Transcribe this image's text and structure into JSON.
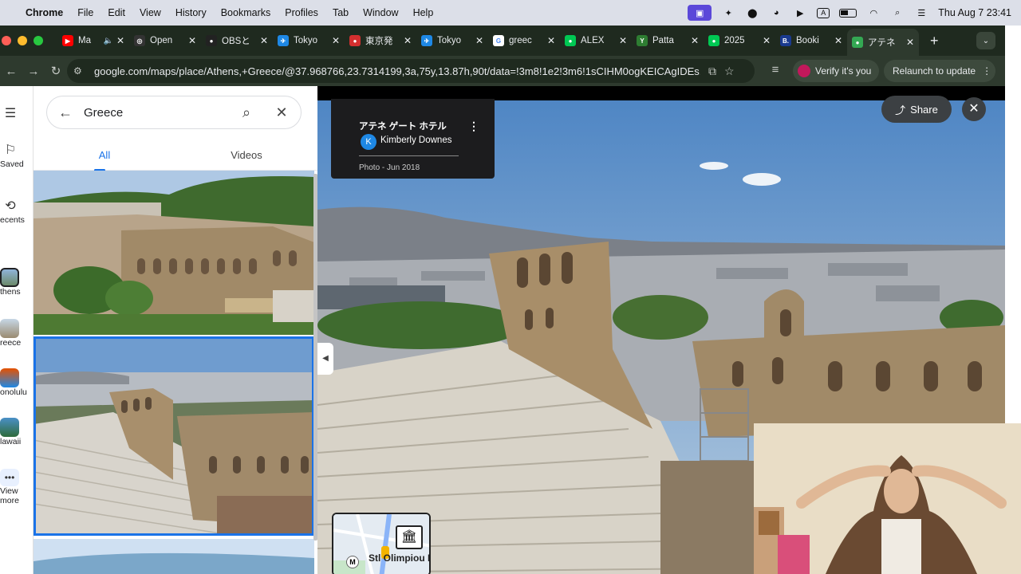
{
  "menubar": {
    "apple": "",
    "app_name": "Chrome",
    "items": [
      "File",
      "Edit",
      "View",
      "History",
      "Bookmarks",
      "Profiles",
      "Tab",
      "Window",
      "Help"
    ],
    "clock": "Thu Aug 7  23:41",
    "input_source": "A"
  },
  "tabs": [
    {
      "label": "Ma",
      "fav_color": "#ff0000",
      "fav_text": "▶",
      "muted": true
    },
    {
      "label": "Open",
      "fav_color": "#333333",
      "fav_text": "◎"
    },
    {
      "label": "OBSと",
      "fav_color": "#222222",
      "fav_text": "●"
    },
    {
      "label": "Tokyo",
      "fav_color": "#1e88e5",
      "fav_text": "✈"
    },
    {
      "label": "東京発",
      "fav_color": "#d32f2f",
      "fav_text": "●"
    },
    {
      "label": "Tokyo",
      "fav_color": "#1e88e5",
      "fav_text": "✈"
    },
    {
      "label": "greec",
      "fav_color": "#ffffff",
      "fav_text": "G"
    },
    {
      "label": "ALEX",
      "fav_color": "#00c853",
      "fav_text": "●"
    },
    {
      "label": "Patta",
      "fav_color": "#2e7d32",
      "fav_text": "Y"
    },
    {
      "label": "2025",
      "fav_color": "#00c853",
      "fav_text": "●"
    },
    {
      "label": "Booki",
      "fav_color": "#1a3a8f",
      "fav_text": "B."
    },
    {
      "label": "アテネ",
      "fav_color": "#34a853",
      "fav_text": "●",
      "active": true
    }
  ],
  "toolbar": {
    "url": "google.com/maps/place/Athens,+Greece/@37.968766,23.7314199,3a,75y,13.87h,90t/data=!3m8!1e2!3m6!1sCIHM0ogKEICAgIDEs...",
    "verify_label": "Verify it's you",
    "relaunch_label": "Relaunch to update"
  },
  "rail": {
    "saved": "Saved",
    "recents": "ecents",
    "athens": "thens",
    "greece": "reece",
    "honolulu": "onolulu",
    "hawaii": "lawaii",
    "view_more_1": "View",
    "view_more_2": "more"
  },
  "search": {
    "query": "Greece",
    "tab_all": "All",
    "tab_videos": "Videos"
  },
  "photo_card": {
    "title": "アテネ ゲート ホテル",
    "avatar_letter": "K",
    "author": "Kimberly Downes",
    "meta": "Photo - Jun 2018"
  },
  "viewer": {
    "share_label": "Share",
    "minimap_label": "Stl Olimpiou Di",
    "metro_letter": "M"
  },
  "colors": {
    "accent": "#1a73e8",
    "tabstrip": "#1f2a1f",
    "toolbar": "#2e3a2e"
  }
}
